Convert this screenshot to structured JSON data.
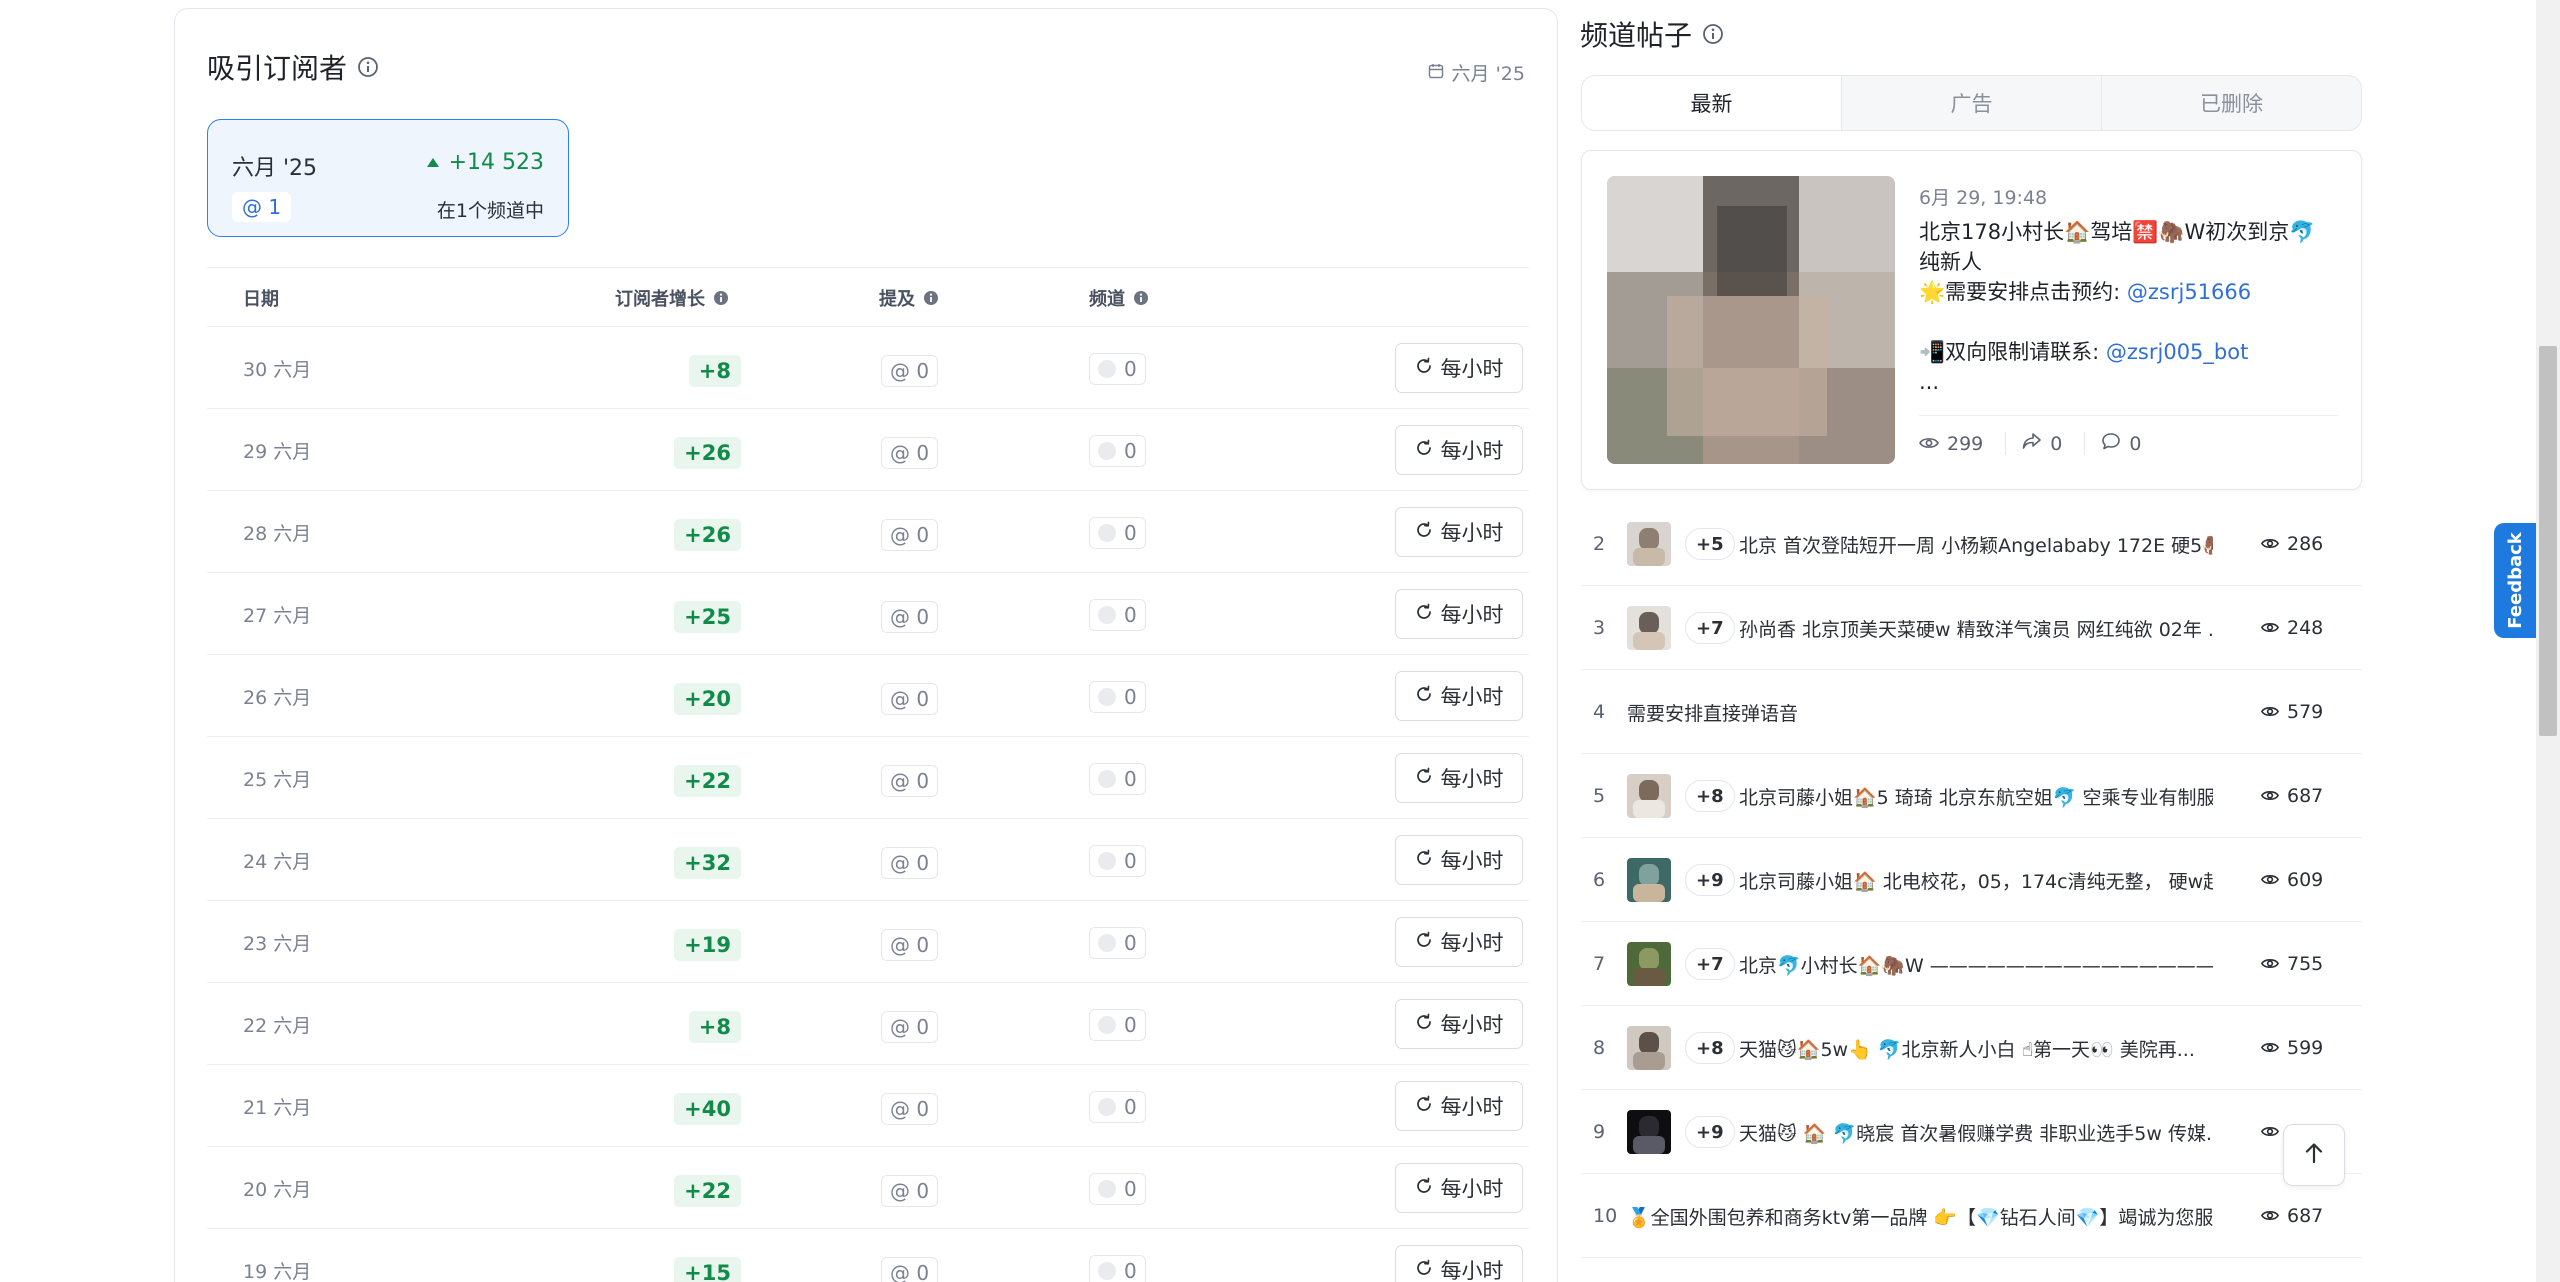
{
  "subscribers": {
    "title": "吸引订阅者",
    "date_label": "六月 '25",
    "summary": {
      "month": "六月 '25",
      "growth": "+14 523",
      "mentions": "@ 1",
      "channels": "在1个频道中"
    },
    "table": {
      "headers": {
        "date": "日期",
        "growth": "订阅者增长",
        "mentions": "提及",
        "channels": "频道"
      },
      "button_label": "每小时",
      "rows": [
        {
          "date": "30 六月",
          "growth": "+8",
          "mentions": "@ 0",
          "channels": "0"
        },
        {
          "date": "29 六月",
          "growth": "+26",
          "mentions": "@ 0",
          "channels": "0"
        },
        {
          "date": "28 六月",
          "growth": "+26",
          "mentions": "@ 0",
          "channels": "0"
        },
        {
          "date": "27 六月",
          "growth": "+25",
          "mentions": "@ 0",
          "channels": "0"
        },
        {
          "date": "26 六月",
          "growth": "+20",
          "mentions": "@ 0",
          "channels": "0"
        },
        {
          "date": "25 六月",
          "growth": "+22",
          "mentions": "@ 0",
          "channels": "0"
        },
        {
          "date": "24 六月",
          "growth": "+32",
          "mentions": "@ 0",
          "channels": "0"
        },
        {
          "date": "23 六月",
          "growth": "+19",
          "mentions": "@ 0",
          "channels": "0"
        },
        {
          "date": "22 六月",
          "growth": "+8",
          "mentions": "@ 0",
          "channels": "0"
        },
        {
          "date": "21 六月",
          "growth": "+40",
          "mentions": "@ 0",
          "channels": "0"
        },
        {
          "date": "20 六月",
          "growth": "+22",
          "mentions": "@ 0",
          "channels": "0"
        },
        {
          "date": "19 六月",
          "growth": "+15",
          "mentions": "@ 0",
          "channels": "0"
        }
      ]
    }
  },
  "posts": {
    "title": "频道帖子",
    "tabs": [
      {
        "label": "最新",
        "active": true
      },
      {
        "label": "广告",
        "active": false
      },
      {
        "label": "已删除",
        "active": false
      }
    ],
    "featured": {
      "timestamp": "6月 29, 19:48",
      "line1": "北京178小村长🏠驾培🈲🦣W初次到京🐬",
      "line2": "纯新人",
      "line3_prefix": "🌟需要安排点击预约: ",
      "line3_link": "@zsrj51666",
      "line4_prefix": "📲双向限制请联系: ",
      "line4_link": "@zsrj005_bot",
      "line5": "...",
      "views": "299",
      "shares": "0",
      "comments": "0"
    },
    "list": [
      {
        "rank": "2",
        "badge": "+5",
        "text": "北京 首次登陆短开一周  小杨颖Angelababy 172E 硬5🦣 ...",
        "views": "286",
        "thumb": "a"
      },
      {
        "rank": "3",
        "badge": "+7",
        "text": "孙尚香 北京顶美天菜硬w 精致洋气演员 网红纯欲  02年  ...",
        "views": "248",
        "thumb": "b"
      },
      {
        "rank": "4",
        "badge": "",
        "text": "需要安排直接弹语音",
        "views": "579",
        "thumb": ""
      },
      {
        "rank": "5",
        "badge": "+8",
        "text": "北京司藤小姐🏠5 琦琦 北京东航空姐🐬 空乘专业有制服...",
        "views": "687",
        "thumb": "c"
      },
      {
        "rank": "6",
        "badge": "+9",
        "text": "北京司藤小姐🏠 北电校花，05，174c清纯无整， 硬w起 ...",
        "views": "609",
        "thumb": "d"
      },
      {
        "rank": "7",
        "badge": "+7",
        "text": "北京🐬小村长🏠🦣W ———————————————...",
        "views": "755",
        "thumb": "e"
      },
      {
        "rank": "8",
        "badge": "+8",
        "text": " 天猫😼🏠5w👆 🐬北京新人小白 ☝第一天👀  美院再...",
        "views": "599",
        "thumb": "f"
      },
      {
        "rank": "9",
        "badge": "+9",
        "text": "天猫😼 🏠 🐬晓宸 首次暑假赚学费 非职业选手5w  传媒...",
        "views": "",
        "thumb": "g"
      },
      {
        "rank": "10",
        "badge": "",
        "text": "🏅全国外围包养和商务ktv第一品牌 👉【💎钻石人间💎】竭诚为您服务...",
        "views": "687",
        "thumb": ""
      }
    ]
  },
  "feedback_label": "Feedback"
}
